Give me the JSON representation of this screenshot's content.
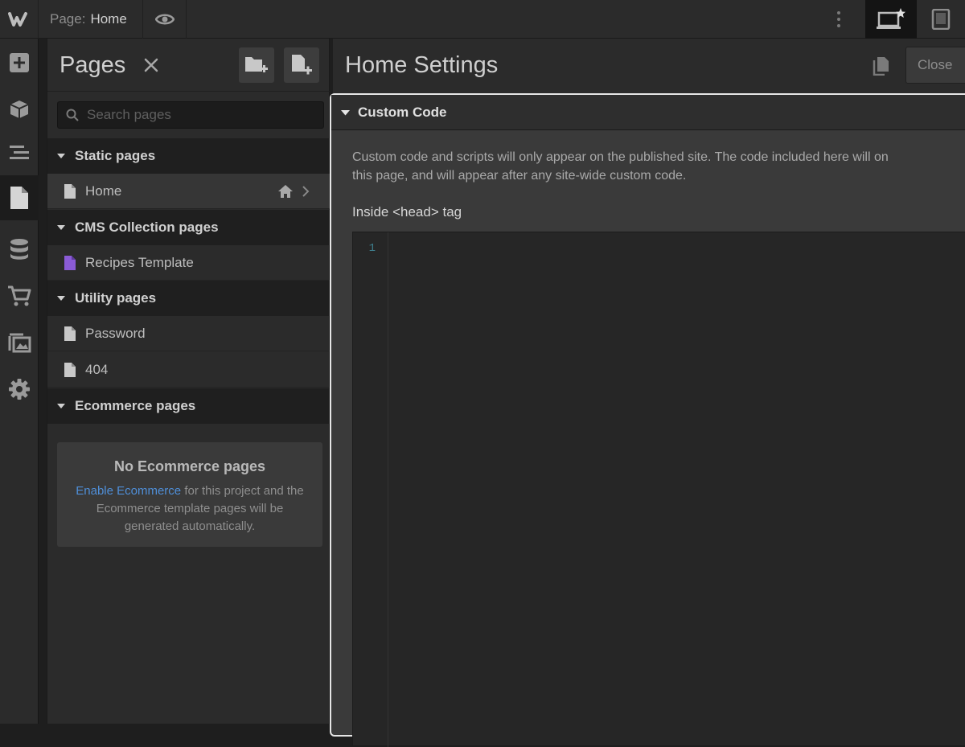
{
  "colors": {
    "bg": "#1e1e1e",
    "panel": "#2b2b2b",
    "section": "#1f1f1f",
    "accent_link": "#4f8fd9",
    "purple_doc": "#8a5bd6",
    "highlight_border": "#e6e6e6"
  },
  "topbar": {
    "logo_icon": "webflow-w-icon",
    "page_label": "Page:",
    "page_value": "Home",
    "preview_icon": "eye-icon",
    "more_icon": "kebab-icon",
    "device_desktop_icon": "desktop-star-icon",
    "device_tablet_icon": "tablet-icon"
  },
  "rail": {
    "items": [
      {
        "icon": "add-icon"
      },
      {
        "icon": "box-icon"
      },
      {
        "icon": "navigator-icon"
      },
      {
        "icon": "pages-icon"
      },
      {
        "icon": "database-icon"
      },
      {
        "icon": "cart-icon"
      },
      {
        "icon": "assets-icon"
      },
      {
        "icon": "gear-icon"
      }
    ]
  },
  "pages_panel": {
    "title": "Pages",
    "search_placeholder": "Search pages",
    "sections": [
      {
        "label": "Static pages"
      },
      {
        "label": "CMS Collection pages"
      },
      {
        "label": "Utility pages"
      },
      {
        "label": "Ecommerce pages"
      }
    ],
    "rows": [
      {
        "label": "Home"
      },
      {
        "label": "Recipes Template"
      },
      {
        "label": "Password"
      },
      {
        "label": "404"
      }
    ],
    "empty_ecommerce": {
      "title": "No Ecommerce pages",
      "link": "Enable Ecommerce",
      "text": " for this project and the Ecommerce template pages will be generated automatically."
    }
  },
  "settings": {
    "title": "Home Settings",
    "close_label": "Close",
    "custom_code": {
      "header": "Custom Code",
      "desc_line1": "Custom code and scripts will only appear on the published site. The code included here will on",
      "desc_line2": "this page, and will appear after any site-wide custom code.",
      "head_label": "Inside <head> tag",
      "line_number": "1"
    }
  }
}
